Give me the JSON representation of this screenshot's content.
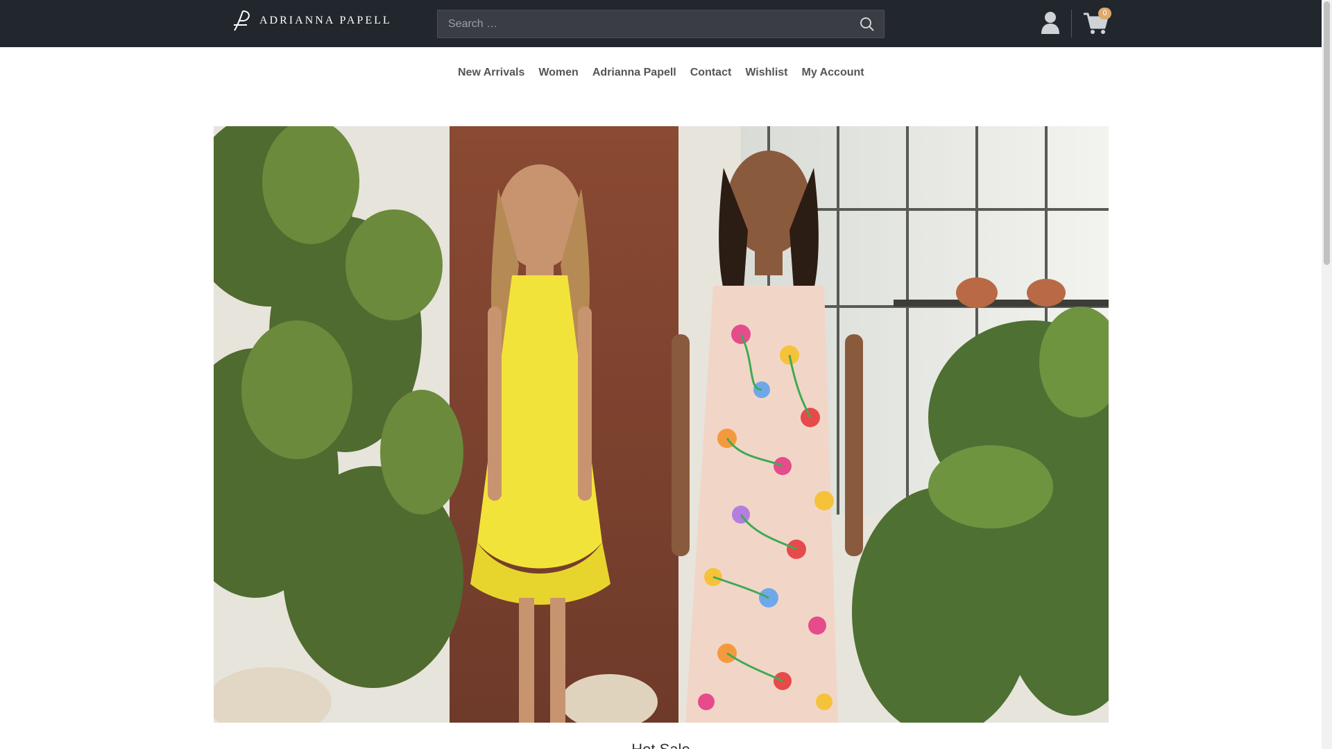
{
  "header": {
    "logo_text": "ADRIANNA PAPELL",
    "search_placeholder": "Search …",
    "cart_count": "0"
  },
  "nav": {
    "items": [
      {
        "label": "New Arrivals"
      },
      {
        "label": "Women"
      },
      {
        "label": "Adrianna Papell"
      },
      {
        "label": "Contact"
      },
      {
        "label": "Wishlist"
      },
      {
        "label": "My Account"
      }
    ]
  },
  "section": {
    "title": "Hot Sale"
  },
  "colors": {
    "header_bg": "#22272e",
    "search_bg": "#3a3e44",
    "nav_text": "#555555",
    "badge": "#e0a96d"
  },
  "icons": {
    "search": "search-icon",
    "account": "user-icon",
    "cart": "shopping-cart-icon"
  }
}
